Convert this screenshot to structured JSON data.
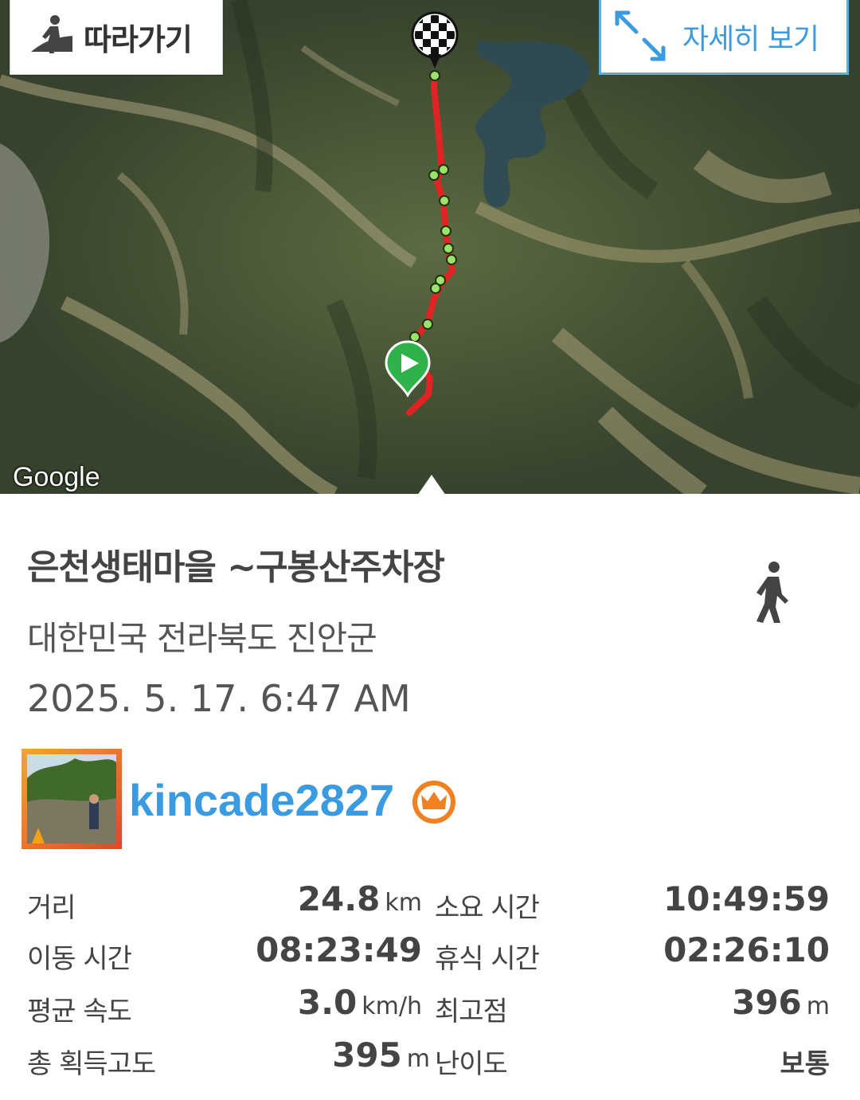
{
  "map": {
    "follow_label": "따라가기",
    "detail_label": "자세히 보기",
    "attribution": "Google",
    "route_color": "#e02424",
    "waypoint_color": "#9be36a"
  },
  "trail": {
    "title": "은천생태마을 ~구봉산주차장",
    "location": "대한민국 전라북도 진안군",
    "datetime": "2025. 5. 17. 6:47 AM",
    "activity_icon": "hiking-icon"
  },
  "user": {
    "name": "kincade2827",
    "badge": "crown-icon",
    "badge_color": "#f08020"
  },
  "stats": [
    {
      "label": "거리",
      "value": "24.8",
      "unit": "km",
      "label2": "소요 시간",
      "value2": "10:49:59",
      "unit2": ""
    },
    {
      "label": "이동 시간",
      "value": "08:23:49",
      "unit": "",
      "label2": "휴식 시간",
      "value2": "02:26:10",
      "unit2": ""
    },
    {
      "label": "평균 속도",
      "value": "3.0",
      "unit": "km/h",
      "label2": "최고점",
      "value2": "396",
      "unit2": "m"
    },
    {
      "label": "총 획득고도",
      "value": "395",
      "unit": "m",
      "label2": "난이도",
      "value2": "보통",
      "unit2": ""
    }
  ]
}
